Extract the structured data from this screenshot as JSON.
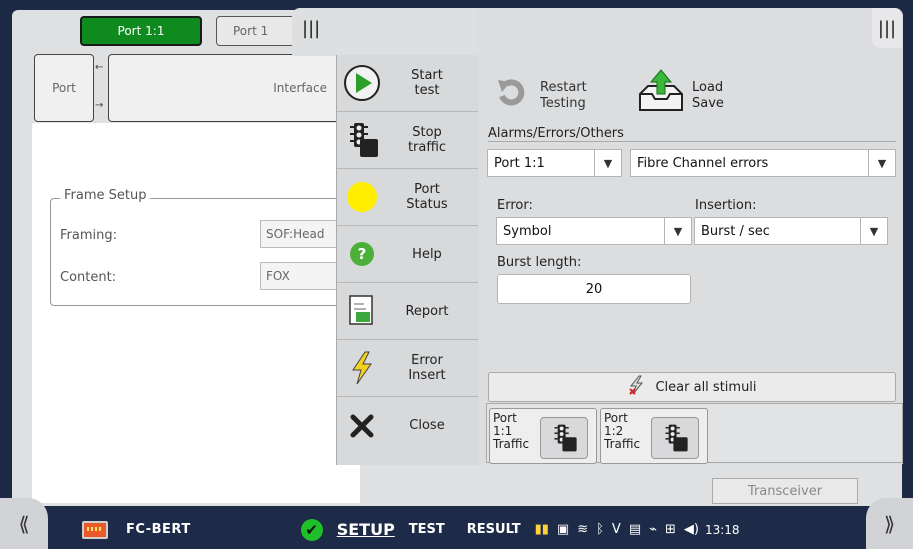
{
  "tabs": {
    "port_1_1": "Port 1:1",
    "port_1_2": "Port 1"
  },
  "blocks": {
    "port": "Port",
    "interface": "Interface"
  },
  "frame_setup": {
    "title": "Frame Setup",
    "framing_label": "Framing:",
    "framing_value": "SOF:Head",
    "content_label": "Content:",
    "content_value": "FOX"
  },
  "transceiver": "Transceiver",
  "menu": {
    "items": [
      {
        "label": "Start\ntest",
        "icon": "play-icon"
      },
      {
        "label": "Stop\ntraffic",
        "icon": "traffic-light-icon"
      },
      {
        "label": "Port\nStatus",
        "icon": "status-circle-icon"
      },
      {
        "label": "Help",
        "icon": "help-icon"
      },
      {
        "label": "Report",
        "icon": "report-icon"
      },
      {
        "label": "Error\nInsert",
        "icon": "lightning-icon"
      },
      {
        "label": "Close",
        "icon": "close-icon"
      }
    ]
  },
  "panel": {
    "restart_label": "Restart\nTesting",
    "load_save_label": "Load\nSave",
    "section_title": "Alarms/Errors/Others",
    "port_select": "Port 1:1",
    "category_select": "Fibre Channel errors",
    "error_label": "Error:",
    "error_value": "Symbol",
    "insertion_label": "Insertion:",
    "insertion_value": "Burst / sec",
    "burst_length_label": "Burst length:",
    "burst_length_value": "20",
    "clear_label": "Clear all stimuli",
    "traffic": [
      {
        "label": "Port\n1:1\nTraffic"
      },
      {
        "label": "Port\n1:2\nTraffic"
      }
    ]
  },
  "statusbar": {
    "app_name": "FC-BERT",
    "setup": "SETUP",
    "test": "TEST",
    "result": "RESULT",
    "clock": "13:18"
  },
  "colors": {
    "active_tab": "#0f8a1e",
    "status_bar": "#1e2b48",
    "ok_green": "#1fbf2a",
    "port_status_yellow": "#ffee00"
  }
}
